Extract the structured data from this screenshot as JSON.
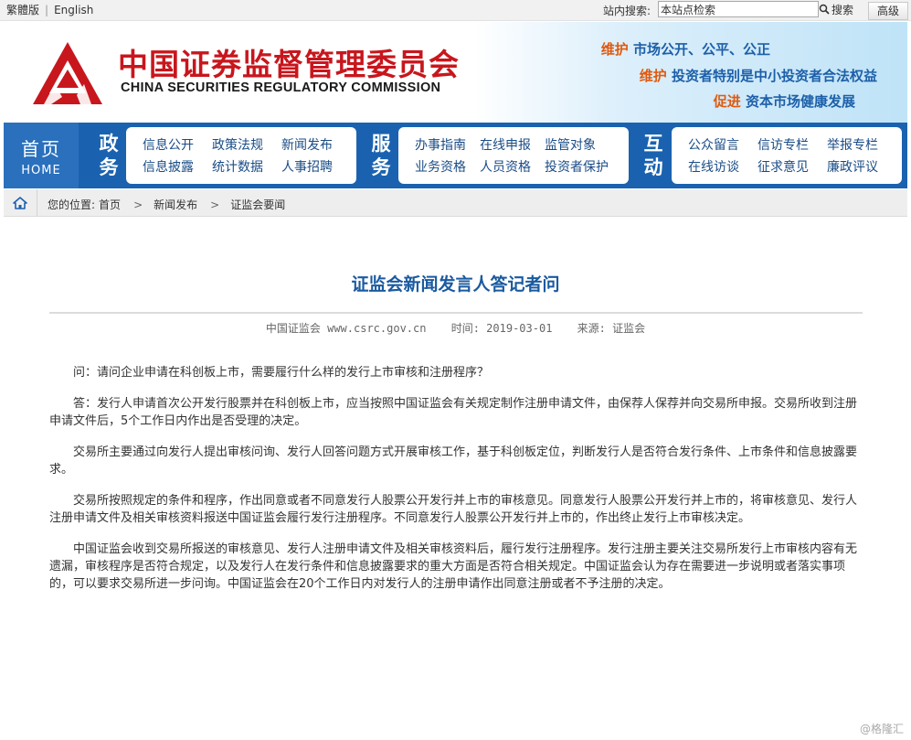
{
  "topbar": {
    "lang_traditional": "繁體版",
    "lang_english": "English",
    "search_label": "站内搜索:",
    "search_value": "本站点检索",
    "search_button": "搜索",
    "advanced_button": "高级"
  },
  "banner": {
    "title_cn": "中国证券监督管理委员会",
    "title_en": "CHINA SECURITIES REGULATORY COMMISSION",
    "slogans": [
      {
        "lead": "维护",
        "rest": "市场公开、公平、公正"
      },
      {
        "lead": "维护",
        "rest": "投资者特别是中小投资者合法权益"
      },
      {
        "lead": "促进",
        "rest": "资本市场健康发展"
      }
    ]
  },
  "nav": {
    "home_cn": "首页",
    "home_en": "HOME",
    "groups": [
      {
        "title_1": "政",
        "title_2": "务",
        "items": [
          "信息公开",
          "政策法规",
          "新闻发布",
          "信息披露",
          "统计数据",
          "人事招聘"
        ]
      },
      {
        "title_1": "服",
        "title_2": "务",
        "items": [
          "办事指南",
          "在线申报",
          "监管对象",
          "业务资格",
          "人员资格",
          "投资者保护"
        ]
      },
      {
        "title_1": "互",
        "title_2": "动",
        "items": [
          "公众留言",
          "信访专栏",
          "举报专栏",
          "在线访谈",
          "征求意见",
          "廉政评议"
        ]
      }
    ]
  },
  "breadcrumb": {
    "label": "您的位置:",
    "items": [
      "首页",
      "新闻发布",
      "证监会要闻"
    ]
  },
  "article": {
    "title": "证监会新闻发言人答记者问",
    "source_site": "中国证监会 www.csrc.gov.cn",
    "time": "时间: 2019-03-01",
    "source": "来源: 证监会",
    "paragraphs": [
      "问：请问企业申请在科创板上市，需要履行什么样的发行上市审核和注册程序？",
      "答：发行人申请首次公开发行股票并在科创板上市，应当按照中国证监会有关规定制作注册申请文件，由保荐人保荐并向交易所申报。交易所收到注册申请文件后，5个工作日内作出是否受理的决定。",
      "交易所主要通过向发行人提出审核问询、发行人回答问题方式开展审核工作，基于科创板定位，判断发行人是否符合发行条件、上市条件和信息披露要求。",
      "交易所按照规定的条件和程序，作出同意或者不同意发行人股票公开发行并上市的审核意见。同意发行人股票公开发行并上市的，将审核意见、发行人注册申请文件及相关审核资料报送中国证监会履行发行注册程序。不同意发行人股票公开发行并上市的，作出终止发行上市审核决定。",
      "中国证监会收到交易所报送的审核意见、发行人注册申请文件及相关审核资料后，履行发行注册程序。发行注册主要关注交易所发行上市审核内容有无遗漏，审核程序是否符合规定，以及发行人在发行条件和信息披露要求的重大方面是否符合相关规定。中国证监会认为存在需要进一步说明或者落实事项的，可以要求交易所进一步问询。中国证监会在20个工作日内对发行人的注册申请作出同意注册或者不予注册的决定。"
    ]
  },
  "watermark": "@格隆汇",
  "colors": {
    "brand_red": "#c8161d",
    "nav_blue": "#1a62b0",
    "title_blue": "#1a5aa0",
    "slogan_orange": "#e05a10"
  }
}
